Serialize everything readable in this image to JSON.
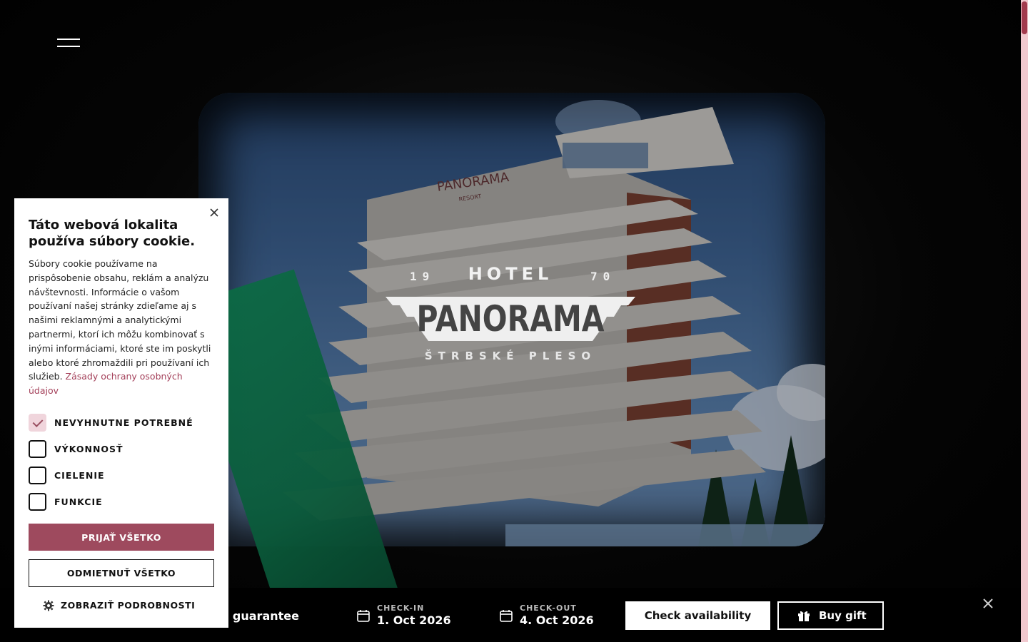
{
  "hero": {
    "logo": {
      "year_left": "19",
      "year_right": "70",
      "top_word": "HOTEL",
      "name": "PANORAMA",
      "place": "ŠTRBSKÉ PLESO"
    },
    "building_sign": "PANORAMA",
    "building_sign_sub": "RESORT"
  },
  "icons": {
    "menu": "hamburger-menu-icon",
    "calendar": "calendar-icon",
    "gift": "gift-icon",
    "close": "close-icon",
    "gear": "gear-icon"
  },
  "colors": {
    "accent": "#9e4a5e",
    "link": "#a4405a",
    "checkbox_checked": "#f0d5dc",
    "scrollbar_track": "#f1c9cf",
    "scrollbar_thumb": "#a23b4e"
  },
  "booking": {
    "guarantee_fragment": "ce guarantee",
    "checkin_label": "CHECK-IN",
    "checkin_value": "1. Oct 2026",
    "checkout_label": "CHECK-OUT",
    "checkout_value": "4. Oct 2026",
    "check_availability": "Check availability",
    "buy_gift": "Buy gift"
  },
  "cookie": {
    "title": "Táto webová lokalita používa súbory cookie.",
    "text": "Súbory cookie používame na prispôsobenie obsahu, reklám a analýzu návštevnosti. Informácie o vašom používaní našej stránky zdieľame aj s našimi reklamnými a analytickými partnermi, ktorí ich môžu kombinovať s inými informáciami, ktoré ste im poskytli alebo ktoré zhromaždili pri používaní ich služieb.",
    "privacy_link": "Zásady ochrany osobných údajov",
    "options": [
      {
        "label": "NEVYHNUTNE POTREBNÉ",
        "checked": true
      },
      {
        "label": "VÝKONNOSŤ",
        "checked": false
      },
      {
        "label": "CIELENIE",
        "checked": false
      },
      {
        "label": "FUNKCIE",
        "checked": false
      }
    ],
    "accept_all": "PRIJAŤ VŠETKO",
    "reject_all": "ODMIETNUŤ VŠETKO",
    "show_details": "ZOBRAZIŤ PODROBNOSTI"
  }
}
